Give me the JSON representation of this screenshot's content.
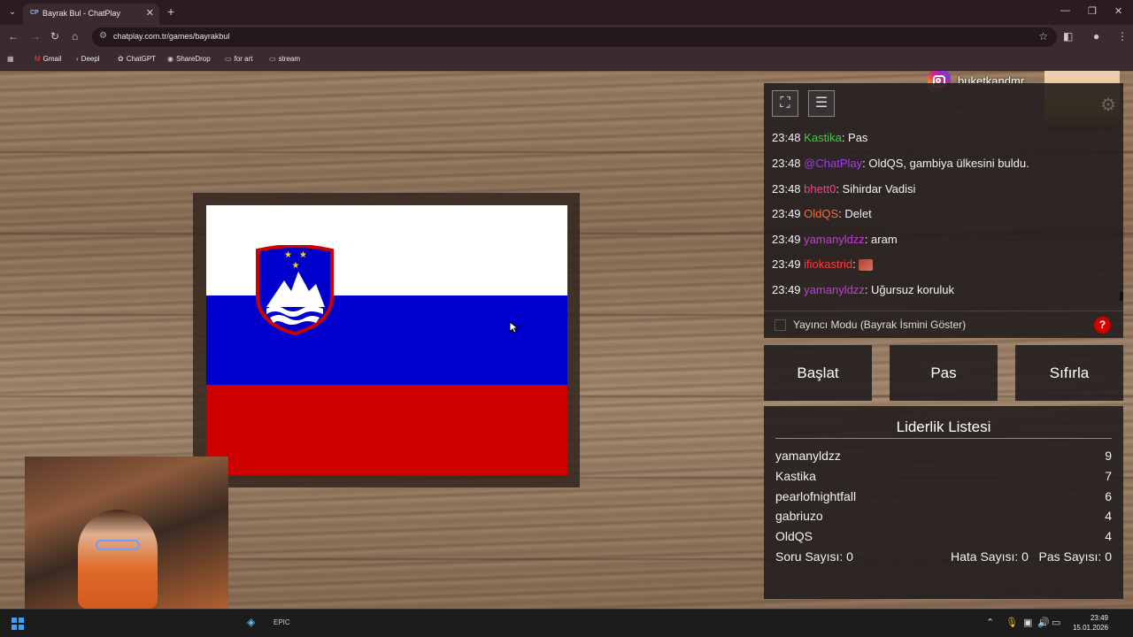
{
  "browser": {
    "tab_icon": "CP",
    "tab_title": "Bayrak Bul - ChatPlay",
    "url": "chatplay.com.tr/games/bayrakbul",
    "bookmarks": [
      "Gmail",
      "Deepl",
      "ChatGPT",
      "ShareDrop",
      "for art",
      "stream"
    ]
  },
  "overlay": {
    "instagram_name": "buketkandmr"
  },
  "chat": {
    "messages": [
      {
        "time": "23:48",
        "user": "Kastika",
        "color": "#3ad13a",
        "text": ": Pas"
      },
      {
        "time": "23:48",
        "user": "@ChatPlay",
        "color": "#9b40e0",
        "text": ": OldQS, gambiya ülkesini buldu."
      },
      {
        "time": "23:48",
        "user": "bhett0",
        "color": "#ff3c8a",
        "text": ": Sihirdar Vadisi"
      },
      {
        "time": "23:49",
        "user": "OldQS",
        "color": "#ff6a2a",
        "text": ": Delet"
      },
      {
        "time": "23:49",
        "user": "yamanyldzz",
        "color": "#c43cd8",
        "text": ": aram"
      },
      {
        "time": "23:49",
        "user": "ifiokastrid",
        "color": "#ff3a3a",
        "text": ":"
      },
      {
        "time": "23:49",
        "user": "yamanyldzz",
        "color": "#c43cd8",
        "text": ": Uğursuz koruluk"
      }
    ],
    "streamer_mode_label": "Yayıncı Modu (Bayrak İsmini Göster)",
    "help_label": "?"
  },
  "actions": {
    "start": "Başlat",
    "pass": "Pas",
    "reset": "Sıfırla"
  },
  "leaderboard": {
    "title": "Liderlik Listesi",
    "rows": [
      {
        "name": "yamanyldzz",
        "score": "9"
      },
      {
        "name": "Kastika",
        "score": "7"
      },
      {
        "name": "pearlofnightfall",
        "score": "6"
      },
      {
        "name": "gabriuzo",
        "score": "4"
      },
      {
        "name": "OldQS",
        "score": "4"
      }
    ],
    "question_count": "Soru Sayısı: 0",
    "error_count": "Hata Sayısı: 0",
    "pass_count": "Pas Sayısı: 0"
  },
  "flag": {
    "colors": {
      "white": "#ffffff",
      "blue": "#0000cc",
      "red": "#cc0000"
    }
  },
  "taskbar": {
    "time": "23:49",
    "date": "15.01.2026"
  }
}
